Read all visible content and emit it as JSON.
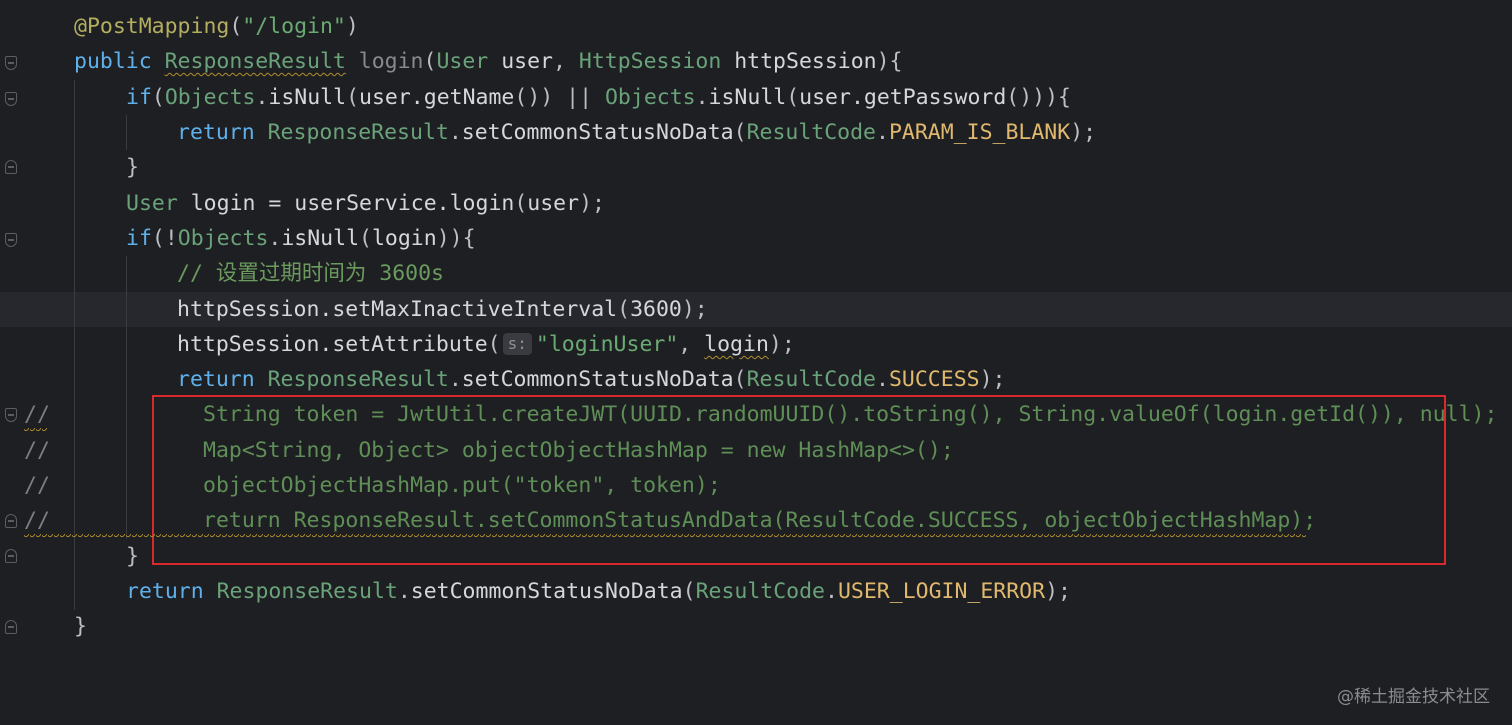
{
  "editor": {
    "watermark": "@稀土掘金技术社区",
    "hint_label": "s:",
    "lines": [
      {
        "tokens": [
          [
            "ann",
            "@PostMapping"
          ],
          [
            "plain",
            "("
          ],
          [
            "str",
            "\"/login\""
          ],
          [
            "plain",
            ")"
          ]
        ]
      },
      {
        "tokens": [
          [
            "kw2",
            "public "
          ],
          [
            "type",
            "ResponseResult"
          ],
          [
            "plain",
            " "
          ],
          [
            "dim",
            "login"
          ],
          [
            "plain",
            "("
          ],
          [
            "type",
            "User"
          ],
          [
            "plain",
            " "
          ],
          [
            "white",
            "user"
          ],
          [
            "plain",
            ", "
          ],
          [
            "type",
            "HttpSession"
          ],
          [
            "plain",
            " "
          ],
          [
            "white",
            "httpSession"
          ],
          [
            "plain",
            "){"
          ]
        ]
      },
      {
        "tokens": [
          [
            "kw2",
            "if"
          ],
          [
            "plain",
            "("
          ],
          [
            "type",
            "Objects"
          ],
          [
            "plain",
            "."
          ],
          [
            "white",
            "isNull"
          ],
          [
            "plain",
            "("
          ],
          [
            "white",
            "user.getName"
          ],
          [
            "plain",
            "()) || "
          ],
          [
            "type",
            "Objects"
          ],
          [
            "plain",
            "."
          ],
          [
            "white",
            "isNull"
          ],
          [
            "plain",
            "("
          ],
          [
            "white",
            "user.getPassword"
          ],
          [
            "plain",
            "())){"
          ]
        ]
      },
      {
        "tokens": [
          [
            "kw2",
            "return "
          ],
          [
            "type",
            "ResponseResult"
          ],
          [
            "plain",
            "."
          ],
          [
            "white",
            "setCommonStatusNoData"
          ],
          [
            "plain",
            "("
          ],
          [
            "type",
            "ResultCode"
          ],
          [
            "plain",
            "."
          ],
          [
            "field",
            "PARAM_IS_BLANK"
          ],
          [
            "plain",
            ");"
          ]
        ]
      },
      {
        "tokens": [
          [
            "plain",
            "}"
          ]
        ]
      },
      {
        "tokens": [
          [
            "type",
            "User"
          ],
          [
            "plain",
            " "
          ],
          [
            "white",
            "login = userService.login"
          ],
          [
            "plain",
            "("
          ],
          [
            "white",
            "user"
          ],
          [
            "plain",
            ");"
          ]
        ]
      },
      {
        "tokens": [
          [
            "kw2",
            "if"
          ],
          [
            "plain",
            "(!"
          ],
          [
            "type",
            "Objects"
          ],
          [
            "plain",
            "."
          ],
          [
            "white",
            "isNull"
          ],
          [
            "plain",
            "("
          ],
          [
            "white",
            "login"
          ],
          [
            "plain",
            ")){"
          ]
        ]
      },
      {
        "tokens": [
          [
            "cmt",
            "// 设置过期时间为 3600s"
          ]
        ]
      },
      {
        "tokens": [
          [
            "white",
            "httpSession.setMaxInactiveInterval"
          ],
          [
            "plain",
            "("
          ],
          [
            "white",
            "3600"
          ],
          [
            "plain",
            ");"
          ]
        ]
      },
      {
        "tokens": [
          [
            "white",
            "httpSession.setAttribute"
          ],
          [
            "plain",
            "("
          ],
          [
            "hint",
            ""
          ],
          [
            "str",
            "\"loginUser\""
          ],
          [
            "plain",
            ", "
          ],
          [
            "white",
            "login"
          ],
          [
            "plain",
            ");"
          ]
        ]
      },
      {
        "tokens": [
          [
            "kw2",
            "return "
          ],
          [
            "type",
            "ResponseResult"
          ],
          [
            "plain",
            "."
          ],
          [
            "white",
            "setCommonStatusNoData"
          ],
          [
            "plain",
            "("
          ],
          [
            "type",
            "ResultCode"
          ],
          [
            "plain",
            "."
          ],
          [
            "field",
            "SUCCESS"
          ],
          [
            "plain",
            ");"
          ]
        ]
      },
      {
        "prefix": "//",
        "tokens": [
          [
            "cmt-line",
            "String token = JwtUtil.createJWT(UUID.randomUUID().toString(), String.valueOf(login.getId()), null);"
          ]
        ]
      },
      {
        "prefix": "//",
        "tokens": [
          [
            "cmt-line",
            "Map<String, Object> objectObjectHashMap = new HashMap<>();"
          ]
        ]
      },
      {
        "prefix": "//",
        "tokens": [
          [
            "cmt-line",
            "objectObjectHashMap.put(\"token\", token);"
          ]
        ]
      },
      {
        "prefix": "//",
        "tokens": [
          [
            "cmt-line",
            "return ResponseResult.setCommonStatusAndData(ResultCode.SUCCESS, objectObjectHashMap);"
          ]
        ]
      },
      {
        "tokens": [
          [
            "plain",
            "}"
          ]
        ]
      },
      {
        "tokens": [
          [
            "kw2",
            "return "
          ],
          [
            "type",
            "ResponseResult"
          ],
          [
            "plain",
            "."
          ],
          [
            "white",
            "setCommonStatusNoData"
          ],
          [
            "plain",
            "("
          ],
          [
            "type",
            "ResultCode"
          ],
          [
            "plain",
            "."
          ],
          [
            "field",
            "USER_LOGIN_ERROR"
          ],
          [
            "plain",
            ");"
          ]
        ]
      },
      {
        "tokens": [
          [
            "plain",
            "}"
          ]
        ]
      }
    ]
  }
}
